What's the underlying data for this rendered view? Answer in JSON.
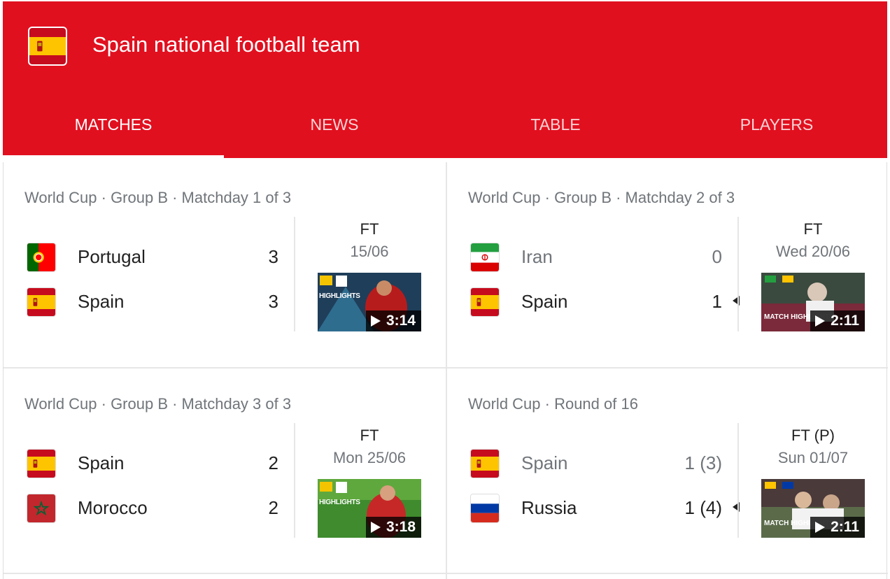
{
  "header": {
    "title": "Spain national football team",
    "accent_color": "#e1101f",
    "logo_icon": "spain-flag-icon"
  },
  "tabs": [
    {
      "label": "MATCHES",
      "active": true
    },
    {
      "label": "NEWS",
      "active": false
    },
    {
      "label": "TABLE",
      "active": false
    },
    {
      "label": "PLAYERS",
      "active": false
    }
  ],
  "matches": [
    {
      "meta": "World Cup · Group B · Matchday 1 of 3",
      "home": {
        "name": "Portugal",
        "score": "3",
        "flag_icon": "portugal-flag-icon"
      },
      "away": {
        "name": "Spain",
        "score": "3",
        "flag_icon": "spain-flag-icon"
      },
      "status": "FT",
      "date": "15/06",
      "video": {
        "badge": "HIGHLIGHTS",
        "duration": "3:14",
        "play_icon": "play-icon"
      }
    },
    {
      "meta": "World Cup · Group B · Matchday 2 of 3",
      "home": {
        "name": "Iran",
        "score": "0",
        "flag_icon": "iran-flag-icon"
      },
      "away": {
        "name": "Spain",
        "score": "1",
        "flag_icon": "spain-flag-icon"
      },
      "winner": "away",
      "status": "FT",
      "date": "Wed 20/06",
      "video": {
        "badge": "MATCH HIGHLIGHTS",
        "duration": "2:11",
        "play_icon": "play-icon"
      }
    },
    {
      "meta": "World Cup · Group B · Matchday 3 of 3",
      "home": {
        "name": "Spain",
        "score": "2",
        "flag_icon": "spain-flag-icon"
      },
      "away": {
        "name": "Morocco",
        "score": "2",
        "flag_icon": "morocco-flag-icon"
      },
      "status": "FT",
      "date": "Mon 25/06",
      "video": {
        "badge": "HIGHLIGHTS",
        "duration": "3:18",
        "play_icon": "play-icon"
      }
    },
    {
      "meta": "World Cup · Round of 16",
      "home": {
        "name": "Spain",
        "score": "1 (3)",
        "flag_icon": "spain-flag-icon"
      },
      "away": {
        "name": "Russia",
        "score": "1 (4)",
        "flag_icon": "russia-flag-icon"
      },
      "winner": "away",
      "status": "FT (P)",
      "date": "Sun 01/07",
      "video": {
        "badge": "MATCH HIGHLIGHTS",
        "duration": "2:11",
        "play_icon": "play-icon"
      }
    }
  ]
}
